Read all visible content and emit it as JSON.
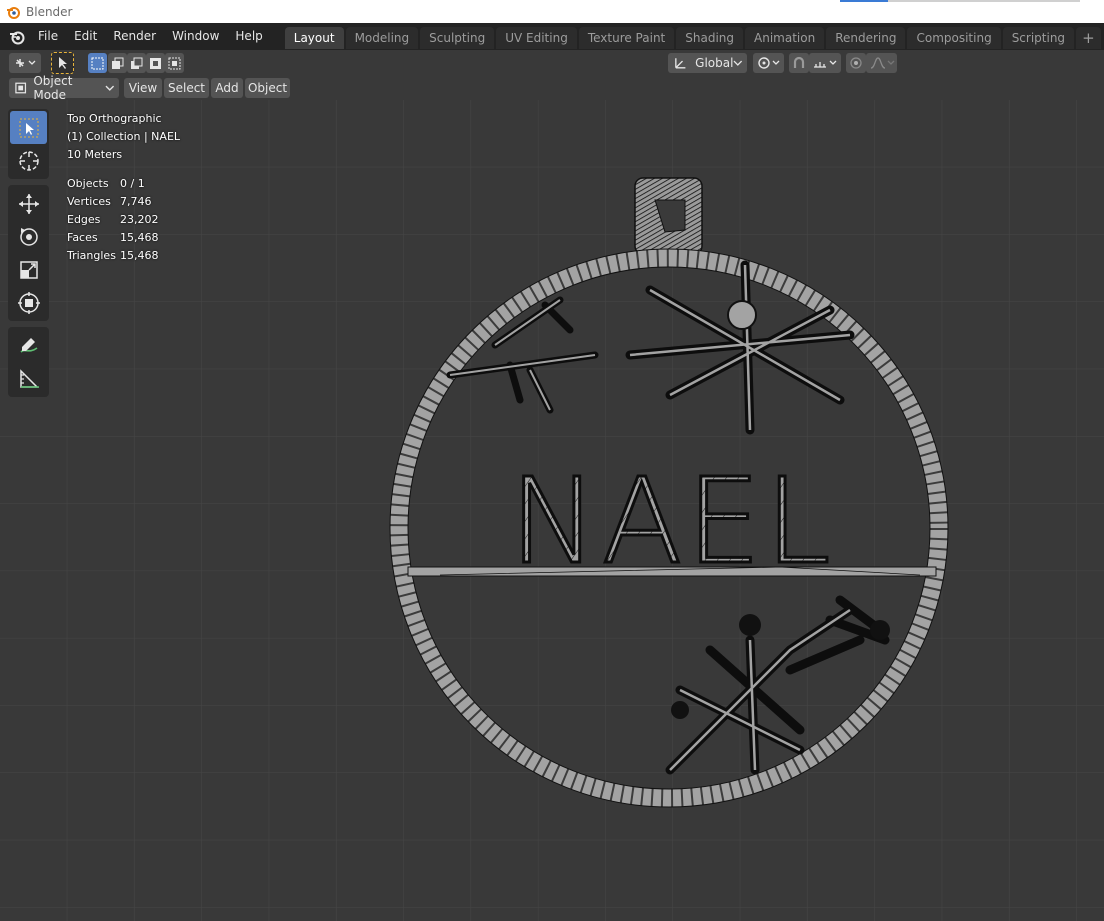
{
  "window": {
    "title": "Blender"
  },
  "menu": {
    "items": [
      "File",
      "Edit",
      "Render",
      "Window",
      "Help"
    ]
  },
  "workspaces": {
    "tabs": [
      "Layout",
      "Modeling",
      "Sculpting",
      "UV Editing",
      "Texture Paint",
      "Shading",
      "Animation",
      "Rendering",
      "Compositing",
      "Scripting"
    ],
    "active": "Layout",
    "add_label": "+"
  },
  "header": {
    "transform_orientation": "Global",
    "mode": "Object Mode",
    "view_label": "View",
    "select_label": "Select",
    "add_label": "Add",
    "object_label": "Object"
  },
  "viewport": {
    "view_name": "Top Orthographic",
    "collection": "(1) Collection | NAEL",
    "scale": "10 Meters",
    "stats": [
      {
        "label": "Objects",
        "value": "0 / 1"
      },
      {
        "label": "Vertices",
        "value": "7,746"
      },
      {
        "label": "Edges",
        "value": "23,202"
      },
      {
        "label": "Faces",
        "value": "15,468"
      },
      {
        "label": "Triangles",
        "value": "15,468"
      }
    ],
    "model_text": "NAEL"
  },
  "colors": {
    "accent": "#5680c2",
    "viewport_bg": "#393939",
    "grid_line": "#464646",
    "mesh_fill": "#a3a3a3",
    "mesh_wire": "#111111"
  }
}
